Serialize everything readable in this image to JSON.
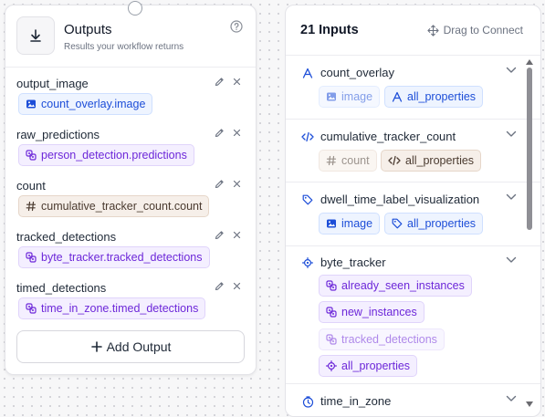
{
  "outputs": {
    "title": "Outputs",
    "subtitle": "Results your workflow returns",
    "items": [
      {
        "name": "output_image",
        "chip": "count_overlay.image",
        "chip_icon": "image-icon",
        "style": "blue"
      },
      {
        "name": "raw_predictions",
        "chip": "person_detection.predictions",
        "chip_icon": "link-icon",
        "style": "purple"
      },
      {
        "name": "count",
        "chip": "cumulative_tracker_count.count",
        "chip_icon": "hash-icon",
        "style": "tan"
      },
      {
        "name": "tracked_detections",
        "chip": "byte_tracker.tracked_detections",
        "chip_icon": "link-icon",
        "style": "purple"
      },
      {
        "name": "timed_detections",
        "chip": "time_in_zone.timed_detections",
        "chip_icon": "link-icon",
        "style": "purple"
      }
    ],
    "add_label": "Add Output"
  },
  "inputs": {
    "title": "21 Inputs",
    "drag_hint": "Drag to Connect",
    "groups": [
      {
        "name": "count_overlay",
        "icon": "text-icon",
        "chips": [
          {
            "label": "image",
            "icon": "image-icon",
            "style": "blue",
            "faded": true
          },
          {
            "label": "all_properties",
            "icon": "text-icon",
            "style": "blue",
            "faded": false
          }
        ]
      },
      {
        "name": "cumulative_tracker_count",
        "icon": "code-icon",
        "chips": [
          {
            "label": "count",
            "icon": "hash-icon",
            "style": "tan",
            "faded": true
          },
          {
            "label": "all_properties",
            "icon": "code-icon",
            "style": "tan",
            "faded": false
          }
        ]
      },
      {
        "name": "dwell_time_label_visualization",
        "icon": "tag-icon",
        "chips": [
          {
            "label": "image",
            "icon": "image-icon",
            "style": "blue",
            "faded": false
          },
          {
            "label": "all_properties",
            "icon": "tag-icon",
            "style": "blue",
            "faded": false
          }
        ]
      },
      {
        "name": "byte_tracker",
        "icon": "target-icon",
        "chips": [
          {
            "label": "already_seen_instances",
            "icon": "link-icon",
            "style": "purple",
            "faded": false
          },
          {
            "label": "new_instances",
            "icon": "link-icon",
            "style": "purple",
            "faded": false
          },
          {
            "label": "tracked_detections",
            "icon": "link-icon",
            "style": "purple",
            "faded": true
          },
          {
            "label": "all_properties",
            "icon": "target-icon",
            "style": "purple",
            "faded": false
          }
        ]
      },
      {
        "name": "time_in_zone",
        "icon": "timer-icon",
        "chips": []
      }
    ]
  },
  "colors": {
    "blue": "#1d4ed8",
    "purple": "#6d28d9",
    "tan": "#4b3b30"
  }
}
